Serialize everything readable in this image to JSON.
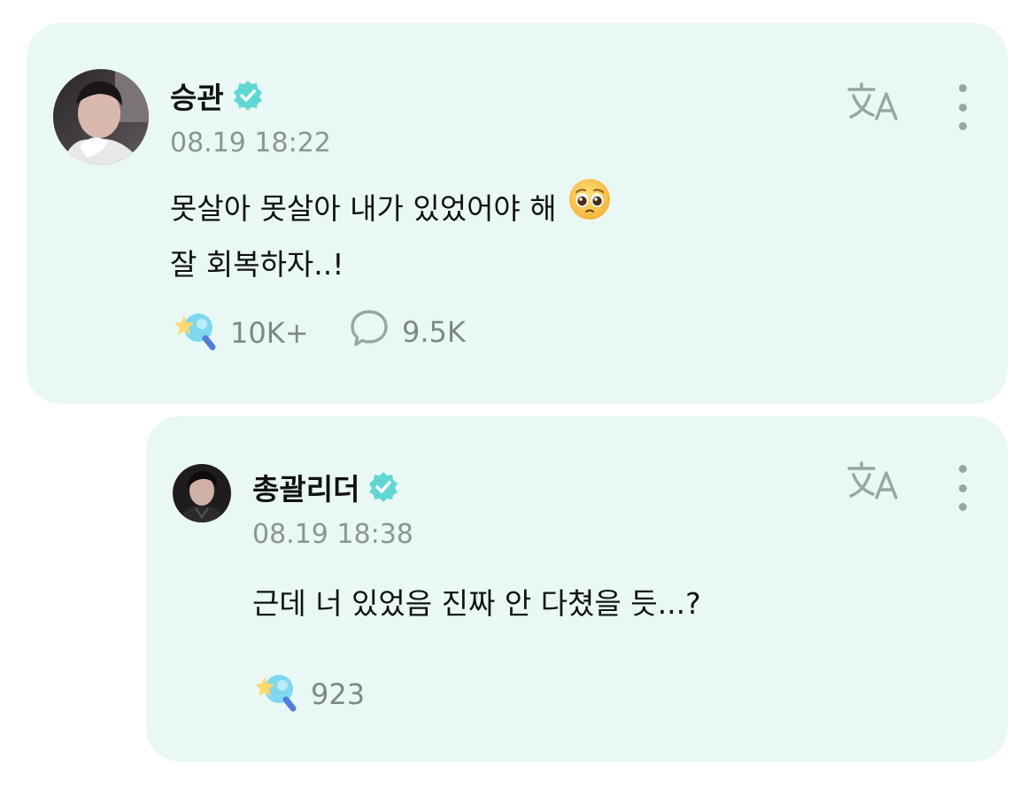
{
  "post": {
    "author": "승관",
    "time": "08.19 18:22",
    "lines": [
      "못살아 못살아 내가 있었어야 해",
      "잘 회복하자..!"
    ],
    "emoji": "pleading-face",
    "likes": "10K+",
    "comments": "9.5K"
  },
  "reply": {
    "author": "총괄리더",
    "time": "08.19 18:38",
    "text": "근데 너 있었음 진짜 안 다쳤을 듯...?",
    "likes": "923"
  },
  "icons": {
    "verified": "verified-badge-icon",
    "translate": "translate-icon",
    "more": "more-vertical-icon",
    "like": "lightstick-icon",
    "comment": "comment-bubble-icon"
  },
  "colors": {
    "card_bg": "#eaf8f5",
    "accent": "#5fd8d2",
    "muted_text": "#8b9592"
  }
}
